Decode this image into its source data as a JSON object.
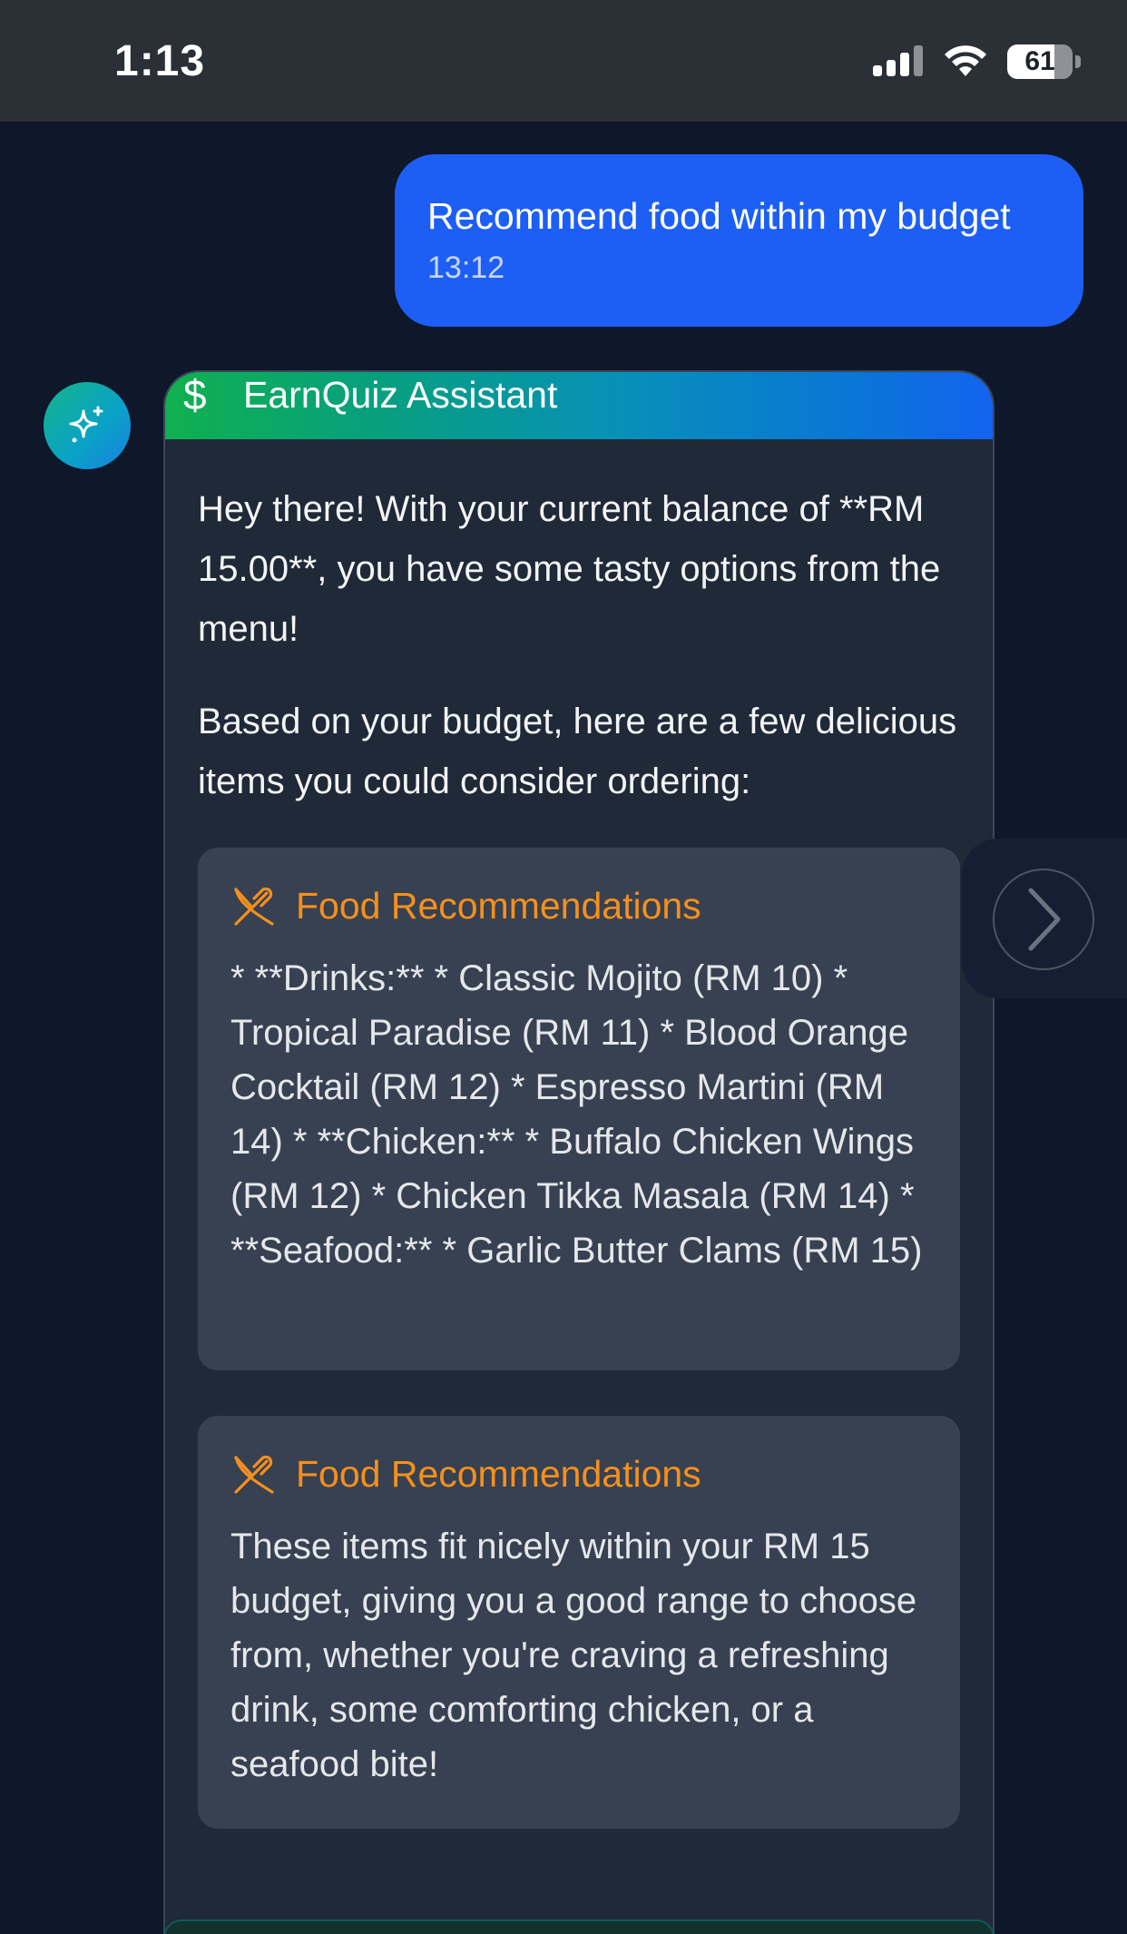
{
  "status_bar": {
    "time": "1:13",
    "battery": "61",
    "icons": [
      "signal-icon",
      "wifi-icon",
      "battery-icon"
    ]
  },
  "user_message": {
    "text": "Recommend food within my budget",
    "time": "13:12"
  },
  "assistant": {
    "name": "EarnQuiz Assistant",
    "header_icon": "$",
    "avatar_icon": "sparkles-icon",
    "paragraphs": [
      "Hey there! With your current balance of **RM 15.00**, you have some tasty options from the menu!",
      "Based on your budget, here are a few delicious items you could consider ordering:"
    ],
    "recommendations": [
      {
        "title": "Food Recommendations",
        "icon": "utensils-crossed-icon",
        "text": "* **Drinks:** * Classic Mojito (RM 10) * Tropical Paradise (RM 11) * Blood Orange Cocktail (RM 12) * Espresso Martini (RM 14) * **Chicken:** * Buffalo Chicken Wings (RM 12) * Chicken Tikka Masala (RM 14) * **Seafood:** * Garlic Butter Clams (RM 15)"
      },
      {
        "title": "Food Recommendations",
        "icon": "utensils-crossed-icon",
        "text": "These items fit nicely within your RM 15 budget, giving you a good range to choose from, whether you're craving a refreshing drink, some comforting chicken, or a seafood bite!"
      }
    ]
  },
  "colors": {
    "background": "#0f172a",
    "user_bubble": "#1d5ff5",
    "card": "#1f2937",
    "rec_box": "#374151",
    "accent_orange": "#f5901e"
  }
}
